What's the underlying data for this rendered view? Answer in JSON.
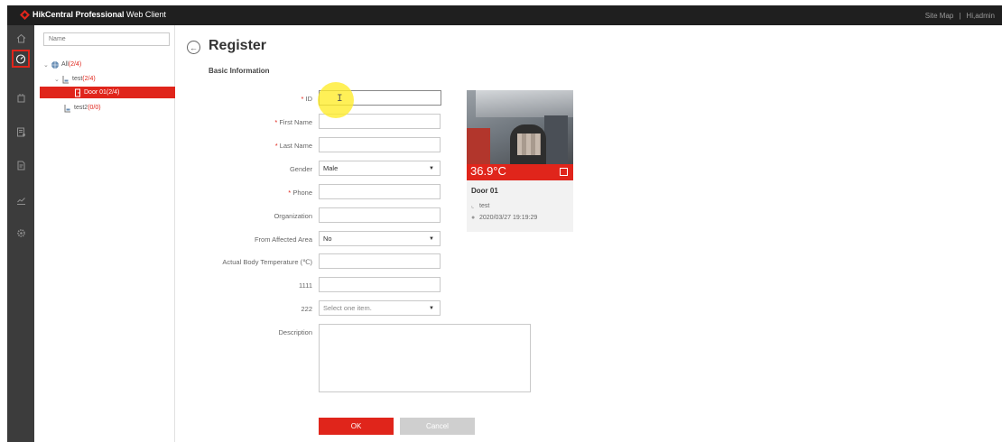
{
  "app": {
    "brand_bold": "HikCentral Professional",
    "brand_light": " Web Client",
    "site_map": "Site Map",
    "separator": "|",
    "user_greeting": "Hi,admin"
  },
  "colors": {
    "accent": "#e0251b",
    "topbar": "#1f1f1f",
    "rail": "#3c3c3c"
  },
  "rail": {
    "items": [
      {
        "icon": "home-icon"
      },
      {
        "icon": "dashboard-icon",
        "active": true
      },
      {
        "icon": "device-icon"
      },
      {
        "icon": "report-icon"
      },
      {
        "icon": "document-icon"
      },
      {
        "icon": "chart-icon"
      },
      {
        "icon": "gear-icon"
      }
    ]
  },
  "tree": {
    "search_placeholder": "Name",
    "nodes": [
      {
        "label": "All",
        "count": "(2/4)"
      },
      {
        "label": "test",
        "count": "(2/4)"
      },
      {
        "label": "Door 01",
        "count": "(2/4)",
        "selected": true
      },
      {
        "label": "test2",
        "count": "(0/0)"
      }
    ]
  },
  "page": {
    "back_icon": "back-arrow-icon",
    "title": "Register",
    "section": "Basic Information"
  },
  "form": {
    "id_label": "ID",
    "first_name_label": "First Name",
    "last_name_label": "Last Name",
    "gender_label": "Gender",
    "gender_value": "Male",
    "phone_label": "Phone",
    "organization_label": "Organization",
    "affected_label": "From Affected Area",
    "affected_value": "No",
    "temperature_label": "Actual Body Temperature (℃)",
    "field_1111_label": "1111",
    "field_222_label": "222",
    "field_222_placeholder": "Select one item.",
    "description_label": "Description",
    "required_mark": "*",
    "ok": "OK",
    "cancel": "Cancel"
  },
  "card": {
    "temperature": "36.9°C",
    "door": "Door 01",
    "group": "test",
    "timestamp": "2020/03/27 19:19:29"
  }
}
